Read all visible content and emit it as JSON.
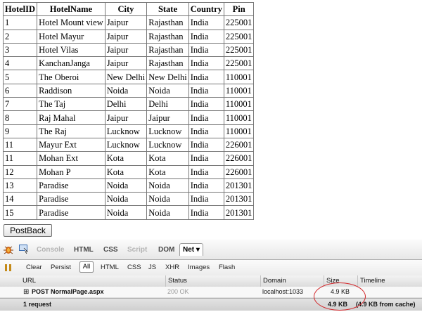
{
  "table": {
    "headers": [
      "HotelID",
      "HotelName",
      "City",
      "State",
      "Country",
      "Pin"
    ],
    "rows": [
      [
        "1",
        "Hotel Mount view",
        "Jaipur",
        "Rajasthan",
        "India",
        "225001"
      ],
      [
        "2",
        "Hotel Mayur",
        "Jaipur",
        "Rajasthan",
        "India",
        "225001"
      ],
      [
        "3",
        "Hotel Vilas",
        "Jaipur",
        "Rajasthan",
        "India",
        "225001"
      ],
      [
        "4",
        "KanchanJanga",
        "Jaipur",
        "Rajasthan",
        "India",
        "225001"
      ],
      [
        "5",
        "The Oberoi",
        "New Delhi",
        "New Delhi",
        "India",
        "110001"
      ],
      [
        "6",
        "Raddison",
        "Noida",
        "Noida",
        "India",
        "110001"
      ],
      [
        "7",
        "The Taj",
        "Delhi",
        "Delhi",
        "India",
        "110001"
      ],
      [
        "8",
        "Raj Mahal",
        "Jaipur",
        "Jaipur",
        "India",
        "110001"
      ],
      [
        "9",
        "The Raj",
        "Lucknow",
        "Lucknow",
        "India",
        "110001"
      ],
      [
        "11",
        "Mayur Ext",
        "Lucknow",
        "Lucknow",
        "India",
        "226001"
      ],
      [
        "11",
        "Mohan Ext",
        "Kota",
        "Kota",
        "India",
        "226001"
      ],
      [
        "12",
        "Mohan P",
        "Kota",
        "Kota",
        "India",
        "226001"
      ],
      [
        "13",
        "Paradise",
        "Noida",
        "Noida",
        "India",
        "201301"
      ],
      [
        "14",
        "Paradise",
        "Noida",
        "Noida",
        "India",
        "201301"
      ],
      [
        "15",
        "Paradise",
        "Noida",
        "Noida",
        "India",
        "201301"
      ]
    ]
  },
  "postback_label": "PostBack",
  "firebug": {
    "tabs": [
      "Console",
      "HTML",
      "CSS",
      "Script",
      "DOM",
      "Net ▾"
    ],
    "toolbar": [
      "Clear",
      "Persist",
      "All",
      "HTML",
      "CSS",
      "JS",
      "XHR",
      "Images",
      "Flash"
    ],
    "columns": [
      "URL",
      "Status",
      "Domain",
      "Size",
      "Timeline"
    ],
    "request": {
      "expander": "⊞",
      "url": "POST NormalPage.aspx",
      "status": "200 OK",
      "domain": "localhost:1033",
      "size": "4.9 KB"
    },
    "footer": {
      "count": "1 request",
      "size": "4.9 KB",
      "cache": "(4.9 KB from cache)"
    }
  },
  "colors": {
    "highlight_ellipse": "#d2262a",
    "grid_border": "#777777"
  },
  "icons": [
    "firebug-bug-icon",
    "inspect-icon",
    "pause-icon"
  ]
}
